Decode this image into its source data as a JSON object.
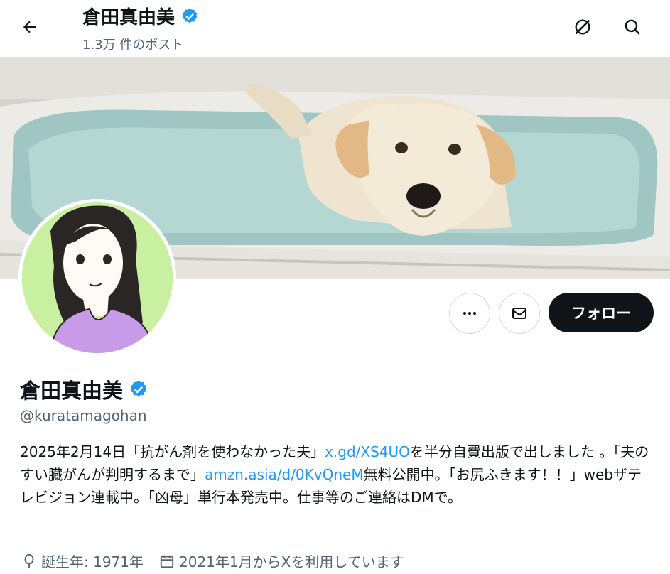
{
  "header": {
    "display_name": "倉田真由美",
    "post_count": "1.3万 件のポスト",
    "back_icon": "arrow-left-icon",
    "grok_icon": "grok-icon",
    "search_icon": "search-icon"
  },
  "banner": {
    "description_icon": "banner-photo"
  },
  "actions": {
    "more_icon": "more-dots-icon",
    "message_icon": "mail-icon",
    "follow_label": "フォロー"
  },
  "profile": {
    "name": "倉田真由美",
    "handle": "@kuratamagohan",
    "verified_color": "#1d9bf0"
  },
  "bio": {
    "part1": "2025年2月14日「抗がん剤を使わなかった夫」",
    "link1": "x.gd/XS4UO",
    "part2": "を半分自費出版で出しました 。「夫のすい臓がんが判明するまで」",
    "link2": "amzn.asia/d/0KvQneM",
    "part3": "無料公開中。「お尻ふきます！！」webザテレビジョン連載中。「凶母」単行本発売中。仕事等のご連絡はDMで。"
  },
  "meta": {
    "birth": "誕生年: 1971年",
    "joined": "2021年1月からXを利用しています"
  }
}
